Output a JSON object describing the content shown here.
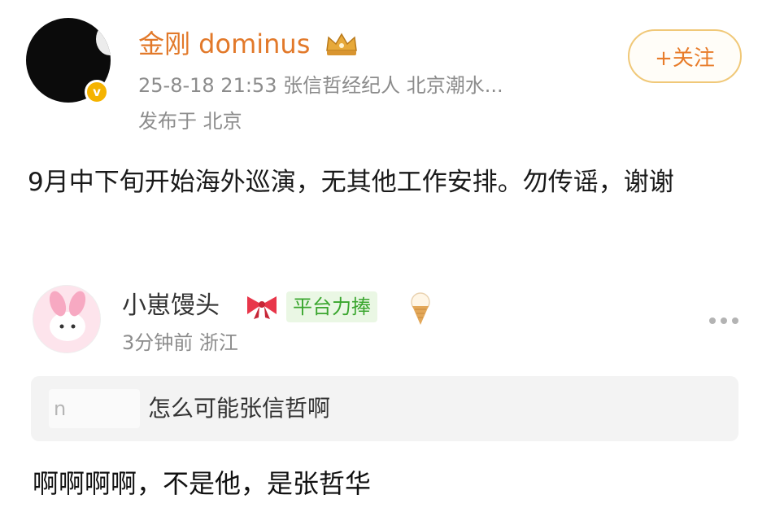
{
  "post": {
    "username": "金刚 dominus",
    "meta": "25-8-18 21:53  张信哲经纪人 北京潮水...",
    "location": "发布于 北京",
    "follow_label": "+关注",
    "content": "9月中下旬开始海外巡演，无其他工作安排。勿传谣，谢谢",
    "verified_badge": "v",
    "icons": [
      "avatar",
      "verified-badge-icon",
      "crown-icon"
    ]
  },
  "comment": {
    "username": "小崽馒头",
    "tag": "平台力捧",
    "time_location": "3分钟前 浙江",
    "quoted_name": "n",
    "quoted_text": "怎么可能张信哲啊",
    "reply": "啊啊啊啊，不是他，是张哲华",
    "icons": [
      "bow-icon",
      "ice-cream-icon",
      "more-icon"
    ]
  },
  "colors": {
    "username": "#e2792a",
    "follow_border": "#f0c878",
    "tag_bg": "#eaf7e4",
    "tag_text": "#3aa62e",
    "muted": "#8c8c8c"
  }
}
